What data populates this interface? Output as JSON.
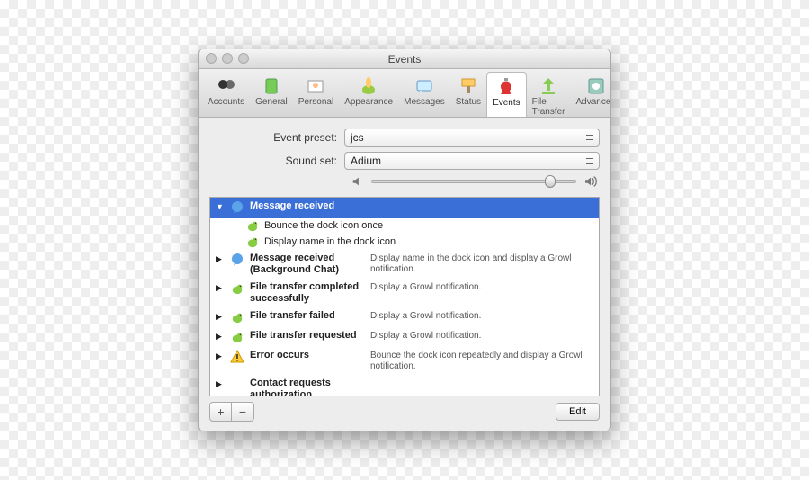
{
  "window": {
    "title": "Events"
  },
  "toolbar": {
    "items": [
      {
        "label": "Accounts",
        "icon": "accounts"
      },
      {
        "label": "General",
        "icon": "general"
      },
      {
        "label": "Personal",
        "icon": "personal"
      },
      {
        "label": "Appearance",
        "icon": "appearance"
      },
      {
        "label": "Messages",
        "icon": "messages"
      },
      {
        "label": "Status",
        "icon": "status"
      },
      {
        "label": "Events",
        "icon": "events"
      },
      {
        "label": "File Transfer",
        "icon": "filetransfer"
      },
      {
        "label": "Advanced",
        "icon": "advanced"
      }
    ],
    "active_index": 6
  },
  "form": {
    "preset_label": "Event preset:",
    "preset_value": "jcs",
    "soundset_label": "Sound set:",
    "soundset_value": "Adium",
    "volume_percent": 85
  },
  "events": [
    {
      "title": "Message received",
      "icon": "bubble-blue",
      "expanded": true,
      "selected": true,
      "children": [
        {
          "icon": "duck-green",
          "text": "Bounce the dock icon once"
        },
        {
          "icon": "duck-green",
          "text": "Display name in the dock icon"
        }
      ]
    },
    {
      "title": "Message received (Background Chat)",
      "icon": "bubble-blue",
      "desc": "Display name in the dock icon and display a Growl notification."
    },
    {
      "title": "File transfer completed successfully",
      "icon": "duck-green",
      "desc": "Display a Growl notification."
    },
    {
      "title": "File transfer failed",
      "icon": "duck-green",
      "desc": "Display a Growl notification."
    },
    {
      "title": "File transfer requested",
      "icon": "duck-green",
      "desc": "Display a Growl notification."
    },
    {
      "title": "Error occurs",
      "icon": "warning",
      "desc": "Bounce the dock icon repeatedly and display a Growl notification."
    },
    {
      "title": "Contact requests authorization",
      "icon": "none",
      "desc": ""
    }
  ],
  "footer": {
    "add_label": "+",
    "remove_label": "−",
    "edit_label": "Edit"
  }
}
